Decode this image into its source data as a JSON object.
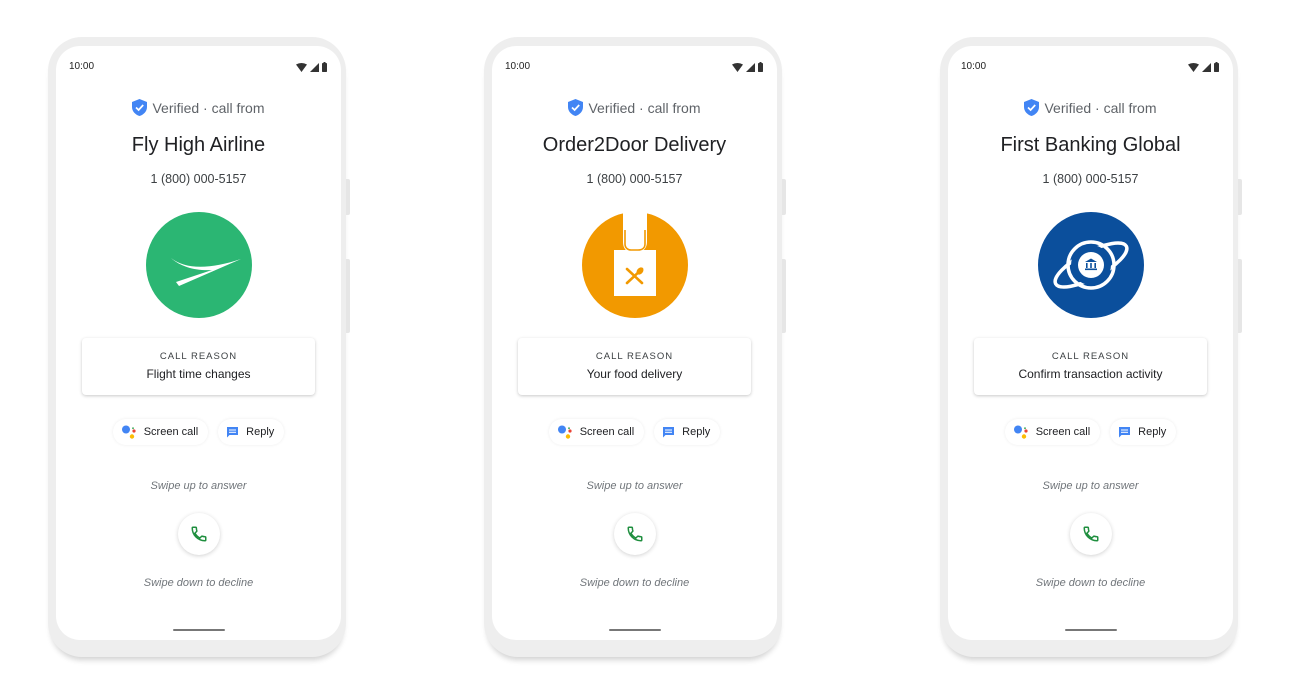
{
  "phones": [
    {
      "status_time": "10:00",
      "verified_text": "Verified · call from",
      "caller_name": "Fly High Airline",
      "phone_number": "1 (800) 000-5157",
      "logo_icon": "airplane-logo-icon",
      "logo_color": "#2bb673",
      "reason_label": "CALL REASON",
      "reason_value": "Flight time changes",
      "screen_call_label": "Screen call",
      "reply_label": "Reply",
      "swipe_up_text": "Swipe up to answer",
      "swipe_down_text": "Swipe down to decline"
    },
    {
      "status_time": "10:00",
      "verified_text": "Verified · call from",
      "caller_name": "Order2Door Delivery",
      "phone_number": "1 (800) 000-5157",
      "logo_icon": "food-delivery-bag-logo-icon",
      "logo_color": "#f29900",
      "reason_label": "CALL REASON",
      "reason_value": "Your food delivery",
      "screen_call_label": "Screen call",
      "reply_label": "Reply",
      "swipe_up_text": "Swipe up to answer",
      "swipe_down_text": "Swipe down to decline"
    },
    {
      "status_time": "10:00",
      "verified_text": "Verified · call from",
      "caller_name": "First Banking Global",
      "phone_number": "1 (800) 000-5157",
      "logo_icon": "bank-planet-logo-icon",
      "logo_color": "#0b4f9c",
      "reason_label": "CALL REASON",
      "reason_value": "Confirm transaction activity",
      "screen_call_label": "Screen call",
      "reply_label": "Reply",
      "swipe_up_text": "Swipe up to answer",
      "swipe_down_text": "Swipe down to decline"
    }
  ],
  "colors": {
    "verified_shield": "#4285f4",
    "answer_icon": "#1e8e3e",
    "reply_icon": "#4285f4"
  }
}
